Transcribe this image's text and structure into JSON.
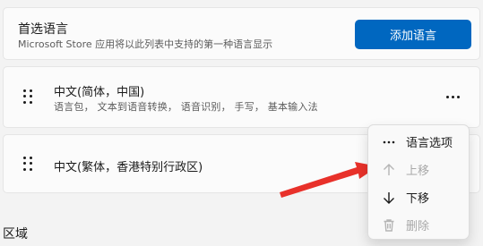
{
  "preferred_languages": {
    "title": "首选语言",
    "description": "Microsoft Store 应用将以此列表中支持的第一种语言显示",
    "add_button_label": "添加语言"
  },
  "languages": [
    {
      "name": "中文(简体，中国)",
      "features": "语言包， 文本到语音转换， 语音识别， 手写， 基本输入法"
    },
    {
      "name": "中文(繁体，香港特别行政区)"
    }
  ],
  "context_menu": {
    "items": [
      {
        "label": "语言选项",
        "icon": "more-icon",
        "enabled": true
      },
      {
        "label": "上移",
        "icon": "arrow-up-icon",
        "enabled": false
      },
      {
        "label": "下移",
        "icon": "arrow-down-icon",
        "enabled": true
      },
      {
        "label": "删除",
        "icon": "trash-icon",
        "enabled": false
      }
    ]
  },
  "region_section": {
    "title": "区域"
  },
  "colors": {
    "accent": "#0067c0",
    "annotation_arrow": "#e8312a"
  }
}
